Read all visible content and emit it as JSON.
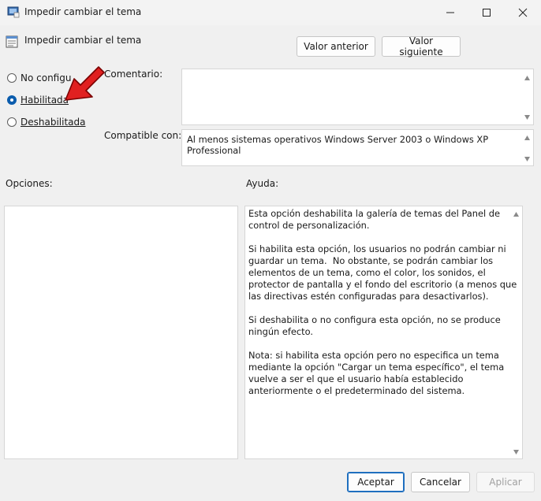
{
  "window": {
    "title": "Impedir cambiar el tema"
  },
  "header": {
    "policy_name": "Impedir cambiar el tema",
    "prev_button": "Valor anterior",
    "next_button": "Valor siguiente"
  },
  "state": {
    "options": [
      {
        "label": "No configu",
        "checked": false
      },
      {
        "label": "Habilitada",
        "checked": true
      },
      {
        "label": "Deshabilitada",
        "checked": false
      }
    ]
  },
  "comment": {
    "label": "Comentario:",
    "value": ""
  },
  "supported": {
    "label": "Compatible con:",
    "value": "Al menos sistemas operativos Windows Server 2003 o Windows XP Professional"
  },
  "options_panel": {
    "label": "Opciones:"
  },
  "help_panel": {
    "label": "Ayuda:",
    "text": "Esta opción deshabilita la galería de temas del Panel de control de personalización.\n\nSi habilita esta opción, los usuarios no podrán cambiar ni guardar un tema.  No obstante, se podrán cambiar los elementos de un tema, como el color, los sonidos, el protector de pantalla y el fondo del escritorio (a menos que las directivas estén configuradas para desactivarlos).\n\nSi deshabilita o no configura esta opción, no se produce ningún efecto.\n\nNota: si habilita esta opción pero no especifica un tema mediante la opción \"Cargar un tema específico\", el tema vuelve a ser el que el usuario había establecido anteriormente o el predeterminado del sistema."
  },
  "footer": {
    "accept": "Aceptar",
    "cancel": "Cancelar",
    "apply": "Aplicar"
  },
  "colors": {
    "accent": "#1f6fbf",
    "arrow": "#e02020"
  }
}
